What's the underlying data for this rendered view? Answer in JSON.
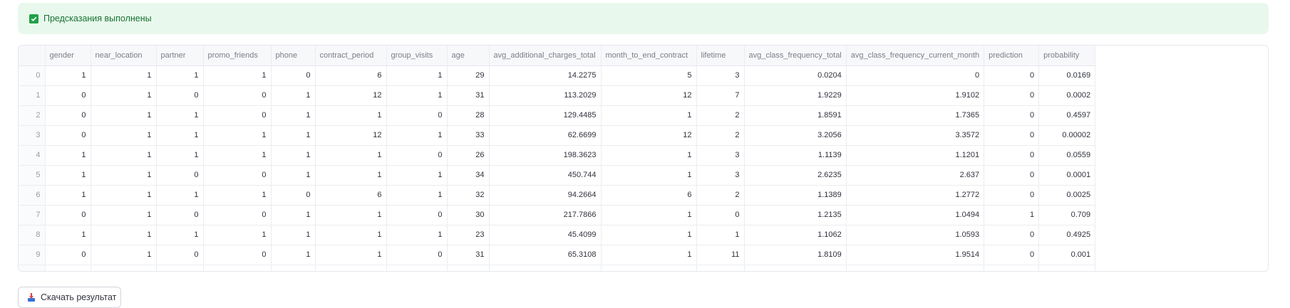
{
  "alert": {
    "text": "Предсказания выполнены",
    "icon": "check-square-icon",
    "color": "#21a048"
  },
  "table": {
    "columns": [
      "",
      "gender",
      "near_location",
      "partner",
      "promo_friends",
      "phone",
      "contract_period",
      "group_visits",
      "age",
      "avg_additional_charges_total",
      "month_to_end_contract",
      "lifetime",
      "avg_class_frequency_total",
      "avg_class_frequency_current_month",
      "prediction",
      "probability"
    ],
    "rows": [
      [
        "0",
        "1",
        "1",
        "1",
        "1",
        "0",
        "6",
        "1",
        "29",
        "14.2275",
        "5",
        "3",
        "0.0204",
        "0",
        "0",
        "0.0169"
      ],
      [
        "1",
        "0",
        "1",
        "0",
        "0",
        "1",
        "12",
        "1",
        "31",
        "113.2029",
        "12",
        "7",
        "1.9229",
        "1.9102",
        "0",
        "0.0002"
      ],
      [
        "2",
        "0",
        "1",
        "1",
        "0",
        "1",
        "1",
        "0",
        "28",
        "129.4485",
        "1",
        "2",
        "1.8591",
        "1.7365",
        "0",
        "0.4597"
      ],
      [
        "3",
        "0",
        "1",
        "1",
        "1",
        "1",
        "12",
        "1",
        "33",
        "62.6699",
        "12",
        "2",
        "3.2056",
        "3.3572",
        "0",
        "0.00002"
      ],
      [
        "4",
        "1",
        "1",
        "1",
        "1",
        "1",
        "1",
        "0",
        "26",
        "198.3623",
        "1",
        "3",
        "1.1139",
        "1.1201",
        "0",
        "0.0559"
      ],
      [
        "5",
        "1",
        "1",
        "0",
        "0",
        "1",
        "1",
        "1",
        "34",
        "450.744",
        "1",
        "3",
        "2.6235",
        "2.637",
        "0",
        "0.0001"
      ],
      [
        "6",
        "1",
        "1",
        "1",
        "1",
        "0",
        "6",
        "1",
        "32",
        "94.2664",
        "6",
        "2",
        "1.1389",
        "1.2772",
        "0",
        "0.0025"
      ],
      [
        "7",
        "0",
        "1",
        "0",
        "0",
        "1",
        "1",
        "0",
        "30",
        "217.7866",
        "1",
        "0",
        "1.2135",
        "1.0494",
        "1",
        "0.709"
      ],
      [
        "8",
        "1",
        "1",
        "1",
        "1",
        "1",
        "1",
        "1",
        "23",
        "45.4099",
        "1",
        "1",
        "1.1062",
        "1.0593",
        "0",
        "0.4925"
      ],
      [
        "9",
        "0",
        "1",
        "0",
        "0",
        "1",
        "1",
        "0",
        "31",
        "65.3108",
        "1",
        "11",
        "1.8109",
        "1.9514",
        "0",
        "0.001"
      ]
    ]
  },
  "download_button": {
    "label": "Скачать результат",
    "icon": "download-icon"
  }
}
